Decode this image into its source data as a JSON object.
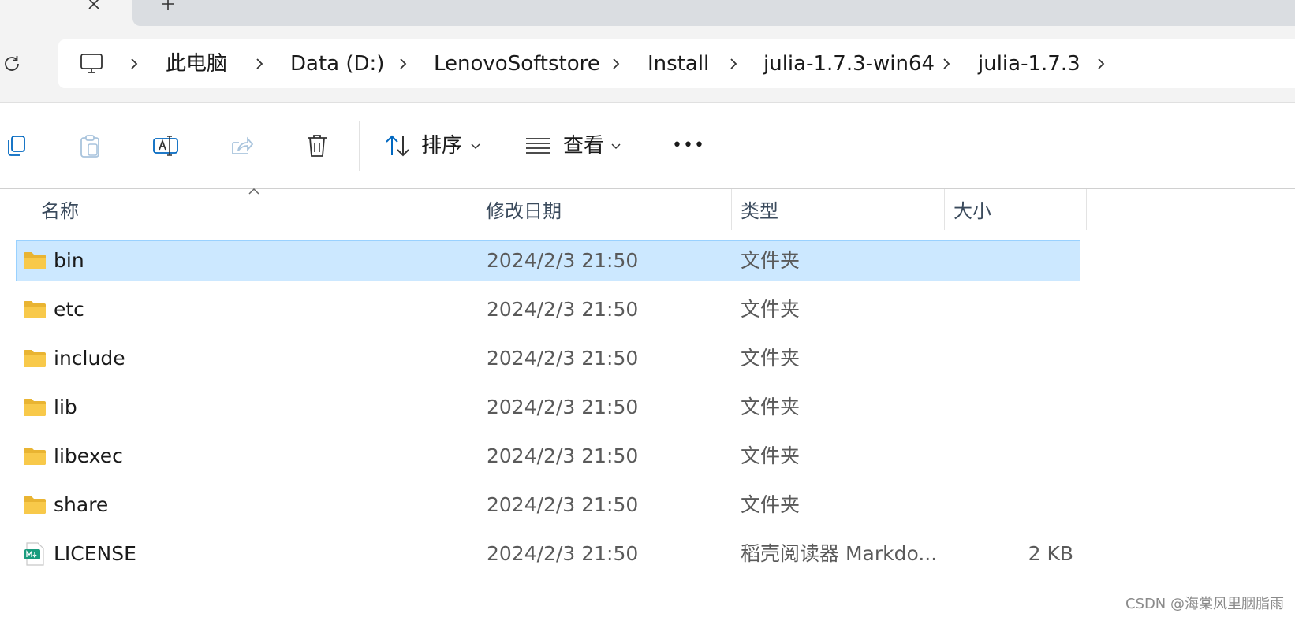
{
  "tabstrip": {
    "close_icon": "close-icon",
    "new_tab_icon": "plus-icon"
  },
  "breadcrumb": {
    "root_icon": "computer-icon",
    "items": [
      "此电脑",
      "Data (D:)",
      "LenovoSoftstore",
      "Install",
      "julia-1.7.3-win64",
      "julia-1.7.3"
    ]
  },
  "toolbar": {
    "sort_label": "排序",
    "view_label": "查看",
    "more_label": "•••"
  },
  "columns": {
    "name": "名称",
    "date": "修改日期",
    "type": "类型",
    "size": "大小"
  },
  "rows": [
    {
      "name": "bin",
      "date": "2024/2/3 21:50",
      "type": "文件夹",
      "size": "",
      "icon": "folder-icon",
      "selected": true
    },
    {
      "name": "etc",
      "date": "2024/2/3 21:50",
      "type": "文件夹",
      "size": "",
      "icon": "folder-icon"
    },
    {
      "name": "include",
      "date": "2024/2/3 21:50",
      "type": "文件夹",
      "size": "",
      "icon": "folder-icon"
    },
    {
      "name": "lib",
      "date": "2024/2/3 21:50",
      "type": "文件夹",
      "size": "",
      "icon": "folder-icon"
    },
    {
      "name": "libexec",
      "date": "2024/2/3 21:50",
      "type": "文件夹",
      "size": "",
      "icon": "folder-icon"
    },
    {
      "name": "share",
      "date": "2024/2/3 21:50",
      "type": "文件夹",
      "size": "",
      "icon": "folder-icon"
    },
    {
      "name": "LICENSE",
      "date": "2024/2/3 21:50",
      "type": "稻壳阅读器 Markdo...",
      "size": "2 KB",
      "icon": "markdown-file-icon"
    }
  ],
  "watermark": "CSDN @海棠风里胭脂雨",
  "colors": {
    "selection": "#cce8ff",
    "selection_border": "#99d1ff",
    "folder": "#f8c94a",
    "accent": "#0067c0"
  }
}
